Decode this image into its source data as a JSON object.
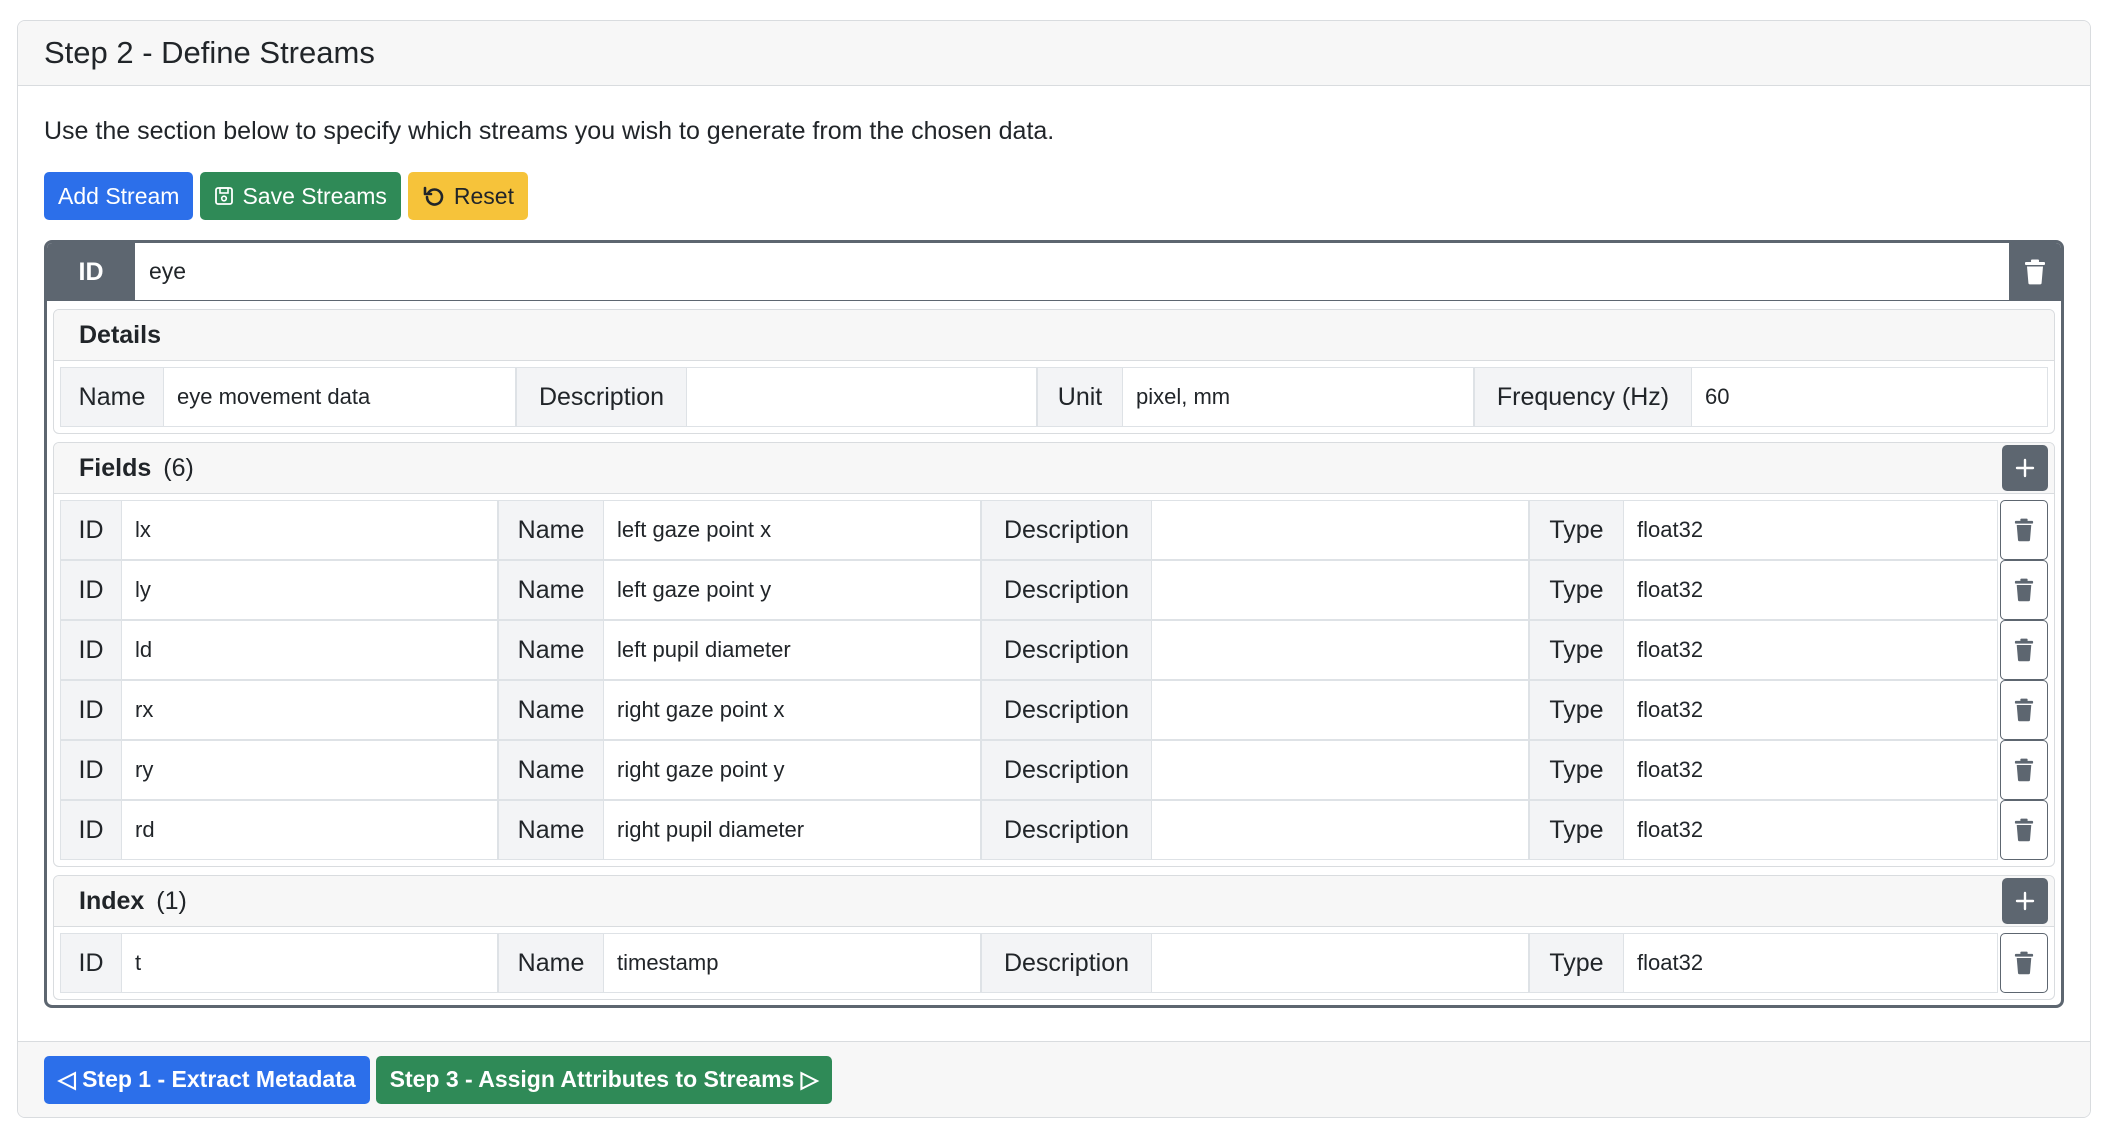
{
  "title": "Step 2 - Define Streams",
  "intro": "Use the section below to specify which streams you wish to generate from the chosen data.",
  "toolbar": {
    "add_stream": "Add Stream",
    "save_streams": "Save Streams",
    "reset": "Reset"
  },
  "stream": {
    "id_label": "ID",
    "id_value": "eye",
    "details": {
      "title": "Details",
      "name_label": "Name",
      "name_value": "eye movement data",
      "description_label": "Description",
      "description_value": "",
      "unit_label": "Unit",
      "unit_value": "pixel, mm",
      "frequency_label": "Frequency (Hz)",
      "frequency_value": "60"
    },
    "fields": {
      "title": "Fields",
      "count": "(6)",
      "rows": [
        {
          "id_label": "ID",
          "id": "lx",
          "name_label": "Name",
          "name": "left gaze point x",
          "description_label": "Description",
          "description": "",
          "type_label": "Type",
          "type": "float32"
        },
        {
          "id_label": "ID",
          "id": "ly",
          "name_label": "Name",
          "name": "left gaze point y",
          "description_label": "Description",
          "description": "",
          "type_label": "Type",
          "type": "float32"
        },
        {
          "id_label": "ID",
          "id": "ld",
          "name_label": "Name",
          "name": "left pupil diameter",
          "description_label": "Description",
          "description": "",
          "type_label": "Type",
          "type": "float32"
        },
        {
          "id_label": "ID",
          "id": "rx",
          "name_label": "Name",
          "name": "right gaze point x",
          "description_label": "Description",
          "description": "",
          "type_label": "Type",
          "type": "float32"
        },
        {
          "id_label": "ID",
          "id": "ry",
          "name_label": "Name",
          "name": "right gaze point y",
          "description_label": "Description",
          "description": "",
          "type_label": "Type",
          "type": "float32"
        },
        {
          "id_label": "ID",
          "id": "rd",
          "name_label": "Name",
          "name": "right pupil diameter",
          "description_label": "Description",
          "description": "",
          "type_label": "Type",
          "type": "float32"
        }
      ]
    },
    "index": {
      "title": "Index",
      "count": "(1)",
      "rows": [
        {
          "id_label": "ID",
          "id": "t",
          "name_label": "Name",
          "name": "timestamp",
          "description_label": "Description",
          "description": "",
          "type_label": "Type",
          "type": "float32"
        }
      ]
    }
  },
  "footer": {
    "prev": "◁ Step 1 - Extract Metadata",
    "next": "Step 3 - Assign Attributes to Streams ▷"
  },
  "icons": {
    "trash": "trash-icon",
    "plus": "plus-icon",
    "save": "floppy-disk-icon",
    "reset": "counterclockwise-arrow-icon"
  },
  "colors": {
    "primary": "#2c6fea",
    "success": "#2f8a57",
    "warning": "#f6c33a",
    "secondary": "#5d6670"
  }
}
